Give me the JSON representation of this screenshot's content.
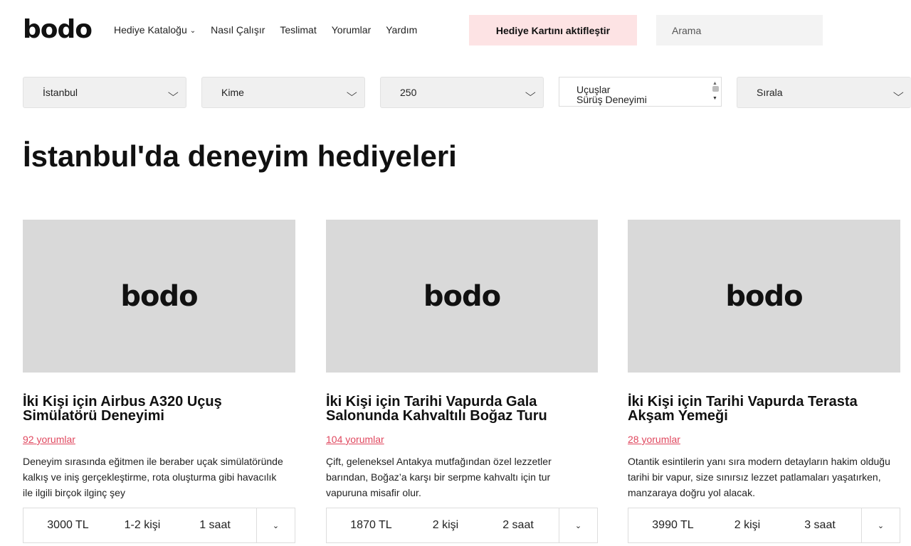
{
  "header": {
    "logo": "bodo",
    "nav": [
      {
        "label": "Hediye Kataloğu",
        "has_dropdown": true
      },
      {
        "label": "Nasıl Çalışır"
      },
      {
        "label": "Teslimat"
      },
      {
        "label": "Yorumlar"
      },
      {
        "label": "Yardım"
      }
    ],
    "activate_label": "Hediye Kartını aktifleştir",
    "search_placeholder": "Arama"
  },
  "filters": {
    "city": "İstanbul",
    "recipient": "Kime",
    "price": "250",
    "categories": [
      "Uçuşlar",
      "Sürüş Deneyimi"
    ],
    "sort": "Sırala"
  },
  "page_title": "İstanbul'da deneyim hediyeleri",
  "products": [
    {
      "image_logo": "bodo",
      "title": "İki Kişi için Airbus A320 Uçuş Simülatörü Deneyimi",
      "reviews": "92 yorumlar",
      "description": "Deneyim sırasında eğitmen ile beraber uçak simülatöründe kalkış ve iniş gerçekleştirme, rota oluşturma gibi havacılık ile ilgili birçok ilginç şey",
      "price": "3000 TL",
      "people": "1-2 kişi",
      "duration": "1 saat"
    },
    {
      "image_logo": "bodo",
      "title": "İki Kişi için Tarihi Vapurda Gala Salonunda Kahvaltılı Boğaz Turu",
      "reviews": "104 yorumlar",
      "description": "Çift, geleneksel Antakya mutfağından özel lezzetler barından, Boğaz’a karşı bir serpme kahvaltı için tur vapuruna misafir olur.",
      "price": "1870 TL",
      "people": "2 kişi",
      "duration": "2 saat"
    },
    {
      "image_logo": "bodo",
      "title": "İki Kişi için Tarihi Vapurda Terasta Akşam Yemeği",
      "reviews": "28 yorumlar",
      "description": "Otantik esintilerin yanı sıra modern detayların hakim olduğu tarihi bir vapur, size sınırsız lezzet patlamaları yaşatırken, manzaraya doğru yol alacak.",
      "price": "3990 TL",
      "people": "2 kişi",
      "duration": "3 saat"
    }
  ],
  "colors": {
    "accent_pink": "#fde3e4",
    "review_link": "#e0485f",
    "placeholder_gray": "#d9d9d9"
  },
  "icons": {
    "dropdown": "chevron-down-icon",
    "expand": "chevron-down-icon"
  }
}
